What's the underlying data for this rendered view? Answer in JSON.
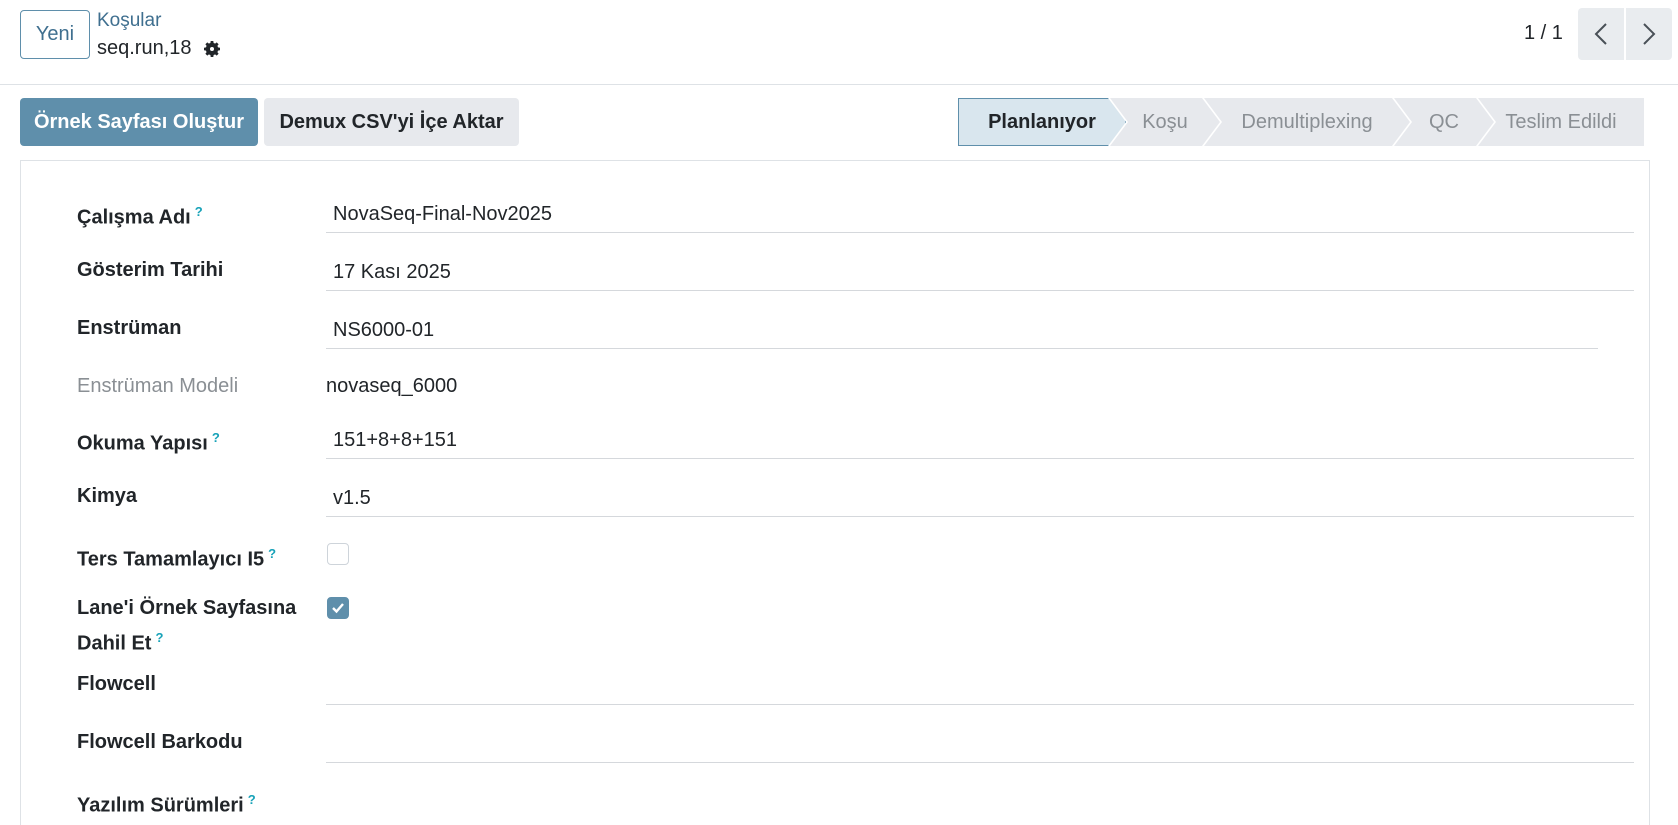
{
  "control_panel": {
    "new_button": "Yeni",
    "breadcrumb_parent": "Koşular",
    "record_name": "seq.run,18",
    "pager_value": "1 / 1"
  },
  "header": {
    "primary_button": "Örnek Sayfası Oluştur",
    "secondary_button": "Demux CSV'yi İçe Aktar",
    "stages": [
      {
        "label": "Planlanıyor",
        "active": true
      },
      {
        "label": "Koşu",
        "active": false
      },
      {
        "label": "Demultiplexing",
        "active": false
      },
      {
        "label": "QC",
        "active": false
      },
      {
        "label": "Teslim Edildi",
        "active": false
      }
    ]
  },
  "form": {
    "fields": [
      {
        "label": "Çalışma Adı",
        "help": "?",
        "value": "NovaSeq-Final-Nov2025"
      },
      {
        "label": "Gösterim Tarihi",
        "value": "17 Kası 2025"
      },
      {
        "label": "Enstrüman",
        "value": "NS6000-01"
      },
      {
        "label": "Enstrüman Modeli",
        "value": "novaseq_6000"
      },
      {
        "label": "Okuma Yapısı",
        "help": "?",
        "value": "151+8+8+151"
      },
      {
        "label": "Kimya",
        "value": "v1.5"
      },
      {
        "label": "Ters Tamamlayıcı I5",
        "help": "?",
        "checked": false
      },
      {
        "label_line1": "Lane'i Örnek Sayfasına",
        "label_line2": "Dahil Et",
        "help": "?",
        "checked": true
      },
      {
        "label": "Flowcell",
        "value": ""
      },
      {
        "label": "Flowcell Barkodu",
        "value": ""
      },
      {
        "label": "Yazılım Sürümleri",
        "help": "?"
      }
    ]
  },
  "colors": {
    "accent": "#5f8fab",
    "help": "#17a2b8",
    "stage_inactive": "#e7e9ed"
  }
}
